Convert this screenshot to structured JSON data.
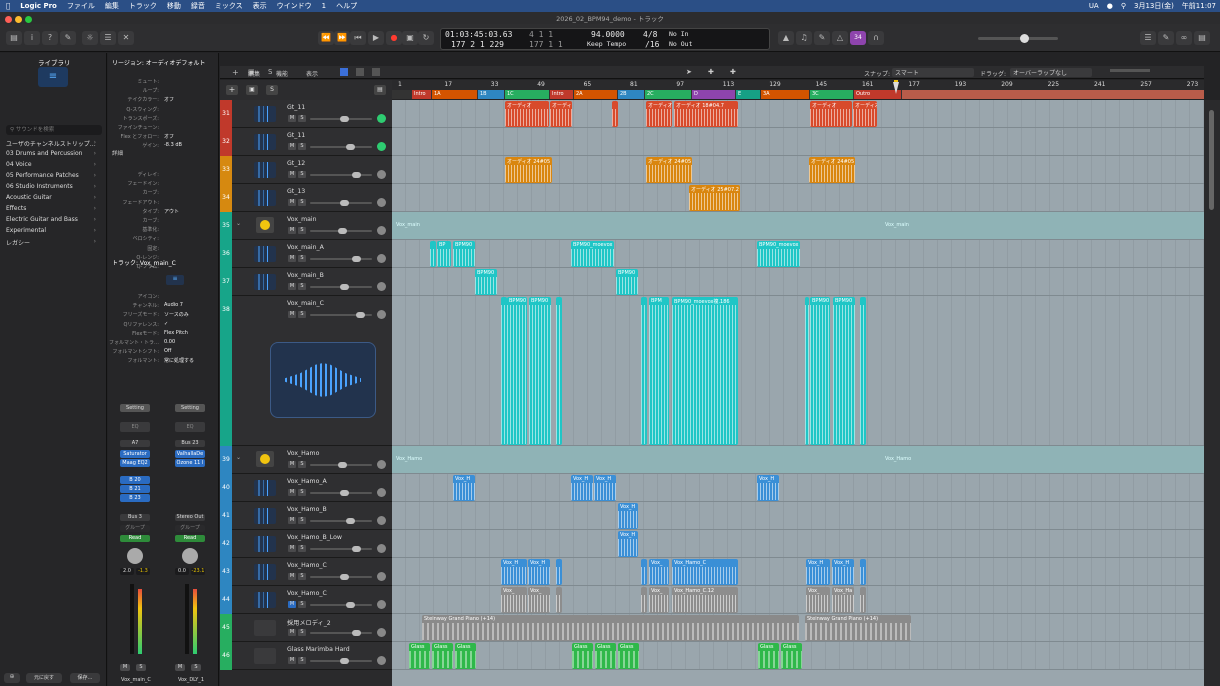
{
  "menubar": {
    "items": [
      "Logic Pro",
      "ファイル",
      "編集",
      "トラック",
      "移動",
      "録音",
      "ミックス",
      "表示",
      "ウインドウ",
      "1",
      "ヘルプ"
    ],
    "right": [
      "UA",
      "3月13日(金)",
      "午前11:07"
    ]
  },
  "window_title": "2026_02_BPM94_demo - トラック",
  "lcd": {
    "time": "01:03:45:03.63",
    "bars": "177  2  1  229",
    "sub1": "4  1  1",
    "sub2": "177  1  1",
    "tempo": "94.0000",
    "tempo_mode": "Keep Tempo",
    "signature": "4/8",
    "division": "/16",
    "in": "No In",
    "out": "No Out"
  },
  "badge": "34",
  "library": {
    "title": "ライブラリ",
    "search_placeholder": "サウンドを検索",
    "items": [
      "ユーザのチャンネルストリップ…",
      "03 Drums and Percussion",
      "04 Voice",
      "05 Performance Patches",
      "06 Studio Instruments",
      "Acoustic Guitar",
      "Effects",
      "Electric Guitar and Bass",
      "Experimental",
      "レガシー"
    ]
  },
  "inspector": {
    "region_header": "リージョン: オーディオデフォルト",
    "region_rows": [
      {
        "k": "ミュート:",
        "v": ""
      },
      {
        "k": "ループ:",
        "v": ""
      },
      {
        "k": "テイクカラー:",
        "v": "オフ"
      },
      {
        "k": "Q-スウィング:",
        "v": ""
      },
      {
        "k": "トランスポーズ:",
        "v": ""
      },
      {
        "k": "ファインチューン:",
        "v": ""
      },
      {
        "k": "Flex とフォロー:",
        "v": "オフ"
      },
      {
        "k": "ゲイン:",
        "v": "-8.3 dB"
      }
    ],
    "detail_header": "詳細",
    "detail_rows": [
      {
        "k": "ディレイ:",
        "v": ""
      },
      {
        "k": "フェードイン:",
        "v": ""
      },
      {
        "k": "カーブ:",
        "v": ""
      },
      {
        "k": "フェードアウト:",
        "v": ""
      },
      {
        "k": "タイプ:",
        "v": "アウト"
      },
      {
        "k": "カーブ:",
        "v": ""
      },
      {
        "k": "基準化:",
        "v": ""
      },
      {
        "k": "ベロシティ:",
        "v": ""
      },
      {
        "k": "固定:",
        "v": ""
      },
      {
        "k": "Q-レンジ:",
        "v": ""
      },
      {
        "k": "Q-フラム:",
        "v": ""
      }
    ],
    "track_header": "トラック: Vox_main_C",
    "track_rows": [
      {
        "k": "アイコン:",
        "v": ""
      },
      {
        "k": "チャンネル:",
        "v": "Audio 7"
      },
      {
        "k": "フリーズモード:",
        "v": "ソースのみ"
      },
      {
        "k": "Qリファレンス:",
        "v": "✓"
      },
      {
        "k": "Flexモード:",
        "v": "Flex Pitch"
      },
      {
        "k": "フォルマント・トラ…",
        "v": "0.00"
      },
      {
        "k": "フォルマントシフト:",
        "v": "Off"
      },
      {
        "k": "フォルマント:",
        "v": "常に処理する"
      }
    ]
  },
  "strips": [
    {
      "setting": "Setting",
      "eq": "EQ",
      "input": "A7",
      "plugins": [
        "Saturator",
        "Maag EQ2"
      ],
      "sends": [
        "B 20",
        "B 21",
        "B 23"
      ],
      "output": "Bus 3",
      "group": "グループ",
      "mode": "Read",
      "vol": "2.0",
      "peak": "-1.3",
      "name": "Vox_main_C"
    },
    {
      "setting": "Setting",
      "eq": "EQ",
      "input": "Bus 23",
      "plugins": [
        "ValhallaDe",
        "Ozone 11 I"
      ],
      "sends": [],
      "output": "Stereo Out",
      "group": "グループ",
      "mode": "Read",
      "vol": "0.0",
      "peak": "-23.1",
      "name": "Vox_DLY_1"
    }
  ],
  "bottom_left": {
    "revert": "元に戻す",
    "save": "保存…"
  },
  "arrange_bar": {
    "menus": [
      "編集",
      "機能",
      "表示"
    ],
    "snap_label": "スナップ:",
    "snap_value": "スマート",
    "drag_label": "ドラッグ:",
    "drag_value": "オーバーラップなし"
  },
  "ruler": [
    "1",
    "17",
    "33",
    "49",
    "65",
    "81",
    "97",
    "113",
    "129",
    "145",
    "161",
    "177",
    "193",
    "209",
    "225",
    "241",
    "257",
    "273"
  ],
  "markers": [
    {
      "l": "Intro",
      "c": "#c0392b"
    },
    {
      "l": "1A",
      "c": "#d35400"
    },
    {
      "l": "1B",
      "c": "#2e86c1"
    },
    {
      "l": "1C",
      "c": "#27ae60"
    },
    {
      "l": "Intro",
      "c": "#c0392b"
    },
    {
      "l": "2A",
      "c": "#d35400"
    },
    {
      "l": "2B",
      "c": "#2e86c1"
    },
    {
      "l": "2C",
      "c": "#27ae60"
    },
    {
      "l": "D",
      "c": "#8e44ad"
    },
    {
      "l": "E",
      "c": "#16a085"
    },
    {
      "l": "3A",
      "c": "#d35400"
    },
    {
      "l": "3C",
      "c": "#27ae60"
    },
    {
      "l": "Outro",
      "c": "#c0392b"
    }
  ],
  "tracks": [
    {
      "num": "31",
      "name": "Gt_11",
      "color": "#c0392b",
      "h": 28
    },
    {
      "num": "32",
      "name": "Gt_11",
      "color": "#c0392b",
      "h": 28
    },
    {
      "num": "33",
      "name": "Gt_12",
      "color": "#d68910",
      "h": 28
    },
    {
      "num": "34",
      "name": "Gt_13",
      "color": "#d68910",
      "h": 28
    },
    {
      "num": "35",
      "name": "Vox_main",
      "color": "#17a589",
      "h": 28
    },
    {
      "num": "36",
      "name": "Vox_main_A",
      "color": "#17a589",
      "h": 28
    },
    {
      "num": "37",
      "name": "Vox_main_B",
      "color": "#17a589",
      "h": 28
    },
    {
      "num": "38",
      "name": "Vox_main_C",
      "color": "#17a589",
      "h": 150
    },
    {
      "num": "39",
      "name": "Vox_Hamo",
      "color": "#2e86c1",
      "h": 28
    },
    {
      "num": "40",
      "name": "Vox_Hamo_A",
      "color": "#2e86c1",
      "h": 28
    },
    {
      "num": "41",
      "name": "Vox_Hamo_B",
      "color": "#2e86c1",
      "h": 28
    },
    {
      "num": "42",
      "name": "Vox_Hamo_B_Low",
      "color": "#2e86c1",
      "h": 28
    },
    {
      "num": "43",
      "name": "Vox_Hamo_C",
      "color": "#2e86c1",
      "h": 28
    },
    {
      "num": "44",
      "name": "Vox_Hamo_C",
      "color": "#2e86c1",
      "h": 28
    },
    {
      "num": "45",
      "name": "採用メロディ_2",
      "color": "#27ae60",
      "h": 28
    },
    {
      "num": "46",
      "name": "Glass Marimba Hard",
      "color": "#27ae60",
      "h": 28
    }
  ],
  "region_labels": {
    "gt11": "オーディオ",
    "gt11b": "オーディオ 18#04.7",
    "gt12": "オーディオ 24#05",
    "gt13": "オーディオ 25#07.2",
    "vox_main": "Vox_main",
    "bpm": "BPM90",
    "bpm_bp": "BP",
    "bpm_moevox": "BPM90_moevox",
    "bpm_moevox_long": "BPM90_moevox複.186",
    "bpm_short": "BPM",
    "vox_hamo": "Vox_Hamo",
    "vox_h": "Vox_H",
    "hamo_c": "Vox_Hamo_C",
    "hamo_c2": "Vox_Hamo_C.12",
    "hamo_v": "Vox_",
    "hamo_vh": "Vox_Ha",
    "piano": "Steinway Grand Piano (+14)",
    "glass": "Glass"
  }
}
